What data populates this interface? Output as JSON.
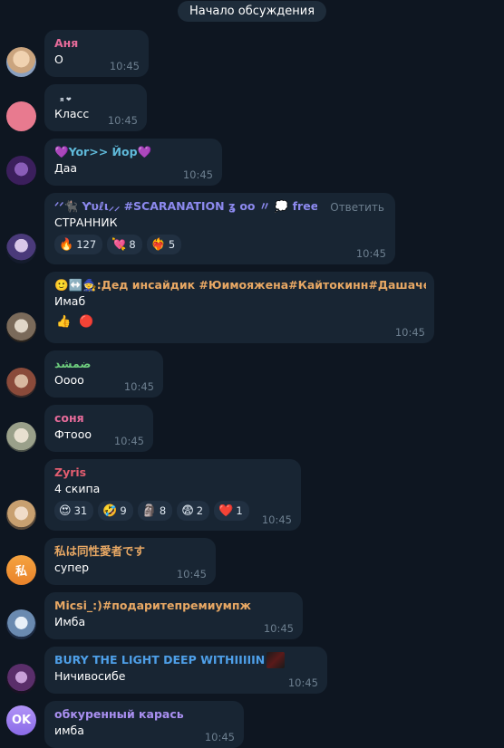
{
  "header": {
    "pill": "Начало обсуждения"
  },
  "reply_label": "Ответить",
  "messages": [
    {
      "name": "Аня",
      "name_color": "#e66b9a",
      "text": "О",
      "time": "10:45"
    },
    {
      "name": "я ❤",
      "text": "Класс",
      "time": "10:45"
    },
    {
      "name": "💜Yor>> Йор💜",
      "name_color": "#5fb9d9",
      "text": "Даа",
      "time": "10:45"
    },
    {
      "name": "ᐟᐟ🐈‍⬛ Ƴυℓι⸝⸝ #SCARANATION ʓ oo  〃 💭 free hugs",
      "name_color": "#8c89ee",
      "text": "СТРАННИК",
      "time": "10:45",
      "reactions": [
        {
          "emoji": "🔥",
          "count": "127"
        },
        {
          "emoji": "💘",
          "count": "8"
        },
        {
          "emoji": "❤️‍🔥",
          "count": "5"
        }
      ]
    },
    {
      "name": "🙂↔️🧙:Дед инсайдик #Юимояжена#Кайтокинн#Дашачер…",
      "name_color": "#e8a864",
      "text": "Имаб",
      "time": "10:45",
      "reactions": [
        {
          "emoji": "👍"
        },
        {
          "emoji": "🔴"
        }
      ]
    },
    {
      "name": "ضمشد",
      "name_color": "#6dcc7d",
      "text": "Оооо",
      "time": "10:45"
    },
    {
      "name": "соня",
      "name_color": "#e66b9a",
      "text": "Фтооо",
      "time": "10:45"
    },
    {
      "name": "Zyris",
      "name_color": "#e35d70",
      "text": "4 скипа",
      "time": "10:45",
      "reactions": [
        {
          "emoji": "😍",
          "count": "31"
        },
        {
          "emoji": "🤣",
          "count": "9"
        },
        {
          "emoji": "🗿",
          "count": "8"
        },
        {
          "emoji": "😨",
          "count": "2"
        },
        {
          "emoji": "❤️",
          "count": "1"
        }
      ]
    },
    {
      "name": "私は同性愛者です",
      "name_color": "#e8a864",
      "text": "супер",
      "time": "10:45",
      "avatar_text": "私"
    },
    {
      "name": "Micsi_:)#подаритепремиумпж",
      "name_color": "#e8a864",
      "text": "Имба",
      "time": "10:45"
    },
    {
      "name": "BURY THE LIGHT DEEP WITHIIIIIN",
      "name_color": "#4e9fe8",
      "text": "Ничивосибе",
      "time": "10:45"
    },
    {
      "name": "обкуренный карась",
      "name_color": "#a98ff0",
      "text": "имба",
      "time": "10:45",
      "avatar_text": "OK"
    }
  ]
}
